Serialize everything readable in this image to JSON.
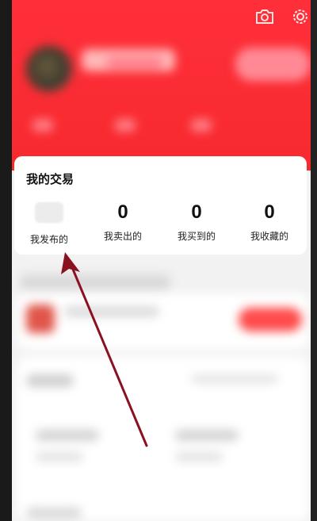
{
  "header": {
    "camera_icon": "camera-icon",
    "settings_icon": "gear-icon",
    "colors": {
      "brand_red": "#f72a2e"
    }
  },
  "trade_card": {
    "title": "我的交易",
    "items": [
      {
        "label": "我发布的",
        "value": null,
        "icon": "placeholder-thumbnail"
      },
      {
        "label": "我卖出的",
        "value": "0"
      },
      {
        "label": "我买到的",
        "value": "0"
      },
      {
        "label": "我收藏的",
        "value": "0"
      }
    ]
  },
  "annotation": {
    "color": "#8b1020"
  }
}
